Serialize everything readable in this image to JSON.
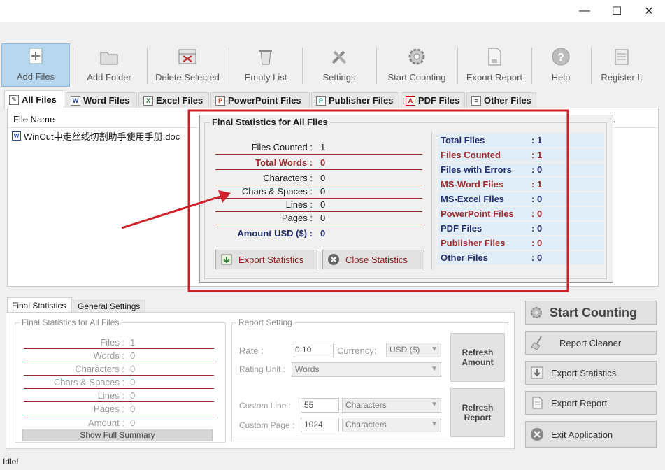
{
  "window": {
    "min": "—",
    "max": "☐",
    "close": "✕"
  },
  "toolbar": {
    "items": [
      {
        "label": "Add Files",
        "icon": "add-files-icon"
      },
      {
        "label": "Add Folder",
        "icon": "add-folder-icon"
      },
      {
        "label": "Delete Selected",
        "icon": "delete-selected-icon"
      },
      {
        "label": "Empty List",
        "icon": "empty-list-icon"
      },
      {
        "label": "Settings",
        "icon": "settings-icon"
      },
      {
        "label": "Start Counting",
        "icon": "start-counting-icon"
      },
      {
        "label": "Export Report",
        "icon": "export-report-icon"
      },
      {
        "label": "Help",
        "icon": "help-icon"
      },
      {
        "label": "Register It",
        "icon": "register-icon"
      }
    ]
  },
  "tabs": [
    {
      "label": "All Files"
    },
    {
      "label": "Word Files"
    },
    {
      "label": "Excel Files"
    },
    {
      "label": "PowerPoint Files"
    },
    {
      "label": "Publisher Files"
    },
    {
      "label": "PDF Files"
    },
    {
      "label": "Other Files"
    }
  ],
  "filelist": {
    "header": "File Name",
    "rows": [
      {
        "name": "WinCut中走丝线切割助手使用手册.doc"
      }
    ],
    "truncated": ".."
  },
  "popup": {
    "title": "Final Statistics for All Files",
    "left": [
      {
        "label": "Files Counted :",
        "value": "1"
      },
      {
        "label": "Total Words :",
        "value": "0"
      },
      {
        "label": "Characters :",
        "value": "0"
      },
      {
        "label": "Chars & Spaces :",
        "value": "0"
      },
      {
        "label": "Lines :",
        "value": "0"
      },
      {
        "label": "Pages :",
        "value": "0"
      },
      {
        "label": "Amount USD ($) :",
        "value": "0"
      }
    ],
    "right": [
      {
        "label": "Total Files",
        "value": ": 1"
      },
      {
        "label": "Files Counted",
        "value": ": 1"
      },
      {
        "label": "Files with Errors",
        "value": ": 0"
      },
      {
        "label": "MS-Word Files",
        "value": ": 1"
      },
      {
        "label": "MS-Excel Files",
        "value": ": 0"
      },
      {
        "label": "PowerPoint Files",
        "value": ": 0"
      },
      {
        "label": "PDF Files",
        "value": ": 0"
      },
      {
        "label": "Publisher Files",
        "value": ": 0"
      },
      {
        "label": "Other Files",
        "value": ": 0"
      }
    ],
    "export_btn": "Export Statistics",
    "close_btn": "Close Statistics"
  },
  "bottom": {
    "tabs": [
      {
        "label": "Final Statistics"
      },
      {
        "label": "General Settings"
      }
    ],
    "summary": {
      "legend": "Final Statistics for All Files",
      "rows": [
        {
          "label": "Files :",
          "value": "1"
        },
        {
          "label": "Words :",
          "value": "0"
        },
        {
          "label": "Characters :",
          "value": "0"
        },
        {
          "label": "Chars & Spaces :",
          "value": "0"
        },
        {
          "label": "Lines :",
          "value": "0"
        },
        {
          "label": "Pages :",
          "value": "0"
        },
        {
          "label": "Amount :",
          "value": "0"
        }
      ],
      "button": "Show Full Summary"
    },
    "report": {
      "legend": "Report Setting",
      "rate_label": "Rate :",
      "rate_value": "0.10",
      "currency_label": "Currency:",
      "currency_value": "USD ($)",
      "rating_unit_label": "Rating Unit :",
      "rating_unit_value": "Words",
      "custom_line_label": "Custom Line :",
      "custom_line_value": "55",
      "custom_line_unit": "Characters",
      "custom_page_label": "Custom Page :",
      "custom_page_value": "1024",
      "custom_page_unit": "Characters",
      "refresh_amount": "Refresh Amount",
      "refresh_report": "Refresh Report"
    }
  },
  "side_buttons": [
    {
      "label": "Start Counting"
    },
    {
      "label": "Report Cleaner"
    },
    {
      "label": "Export Statistics"
    },
    {
      "label": "Export Report"
    },
    {
      "label": "Exit Application"
    }
  ],
  "status": "Idle!",
  "colors": {
    "accent_red": "#9c2b2b",
    "accent_navy": "#1f2d6e",
    "annotation_red": "#d0202a"
  }
}
